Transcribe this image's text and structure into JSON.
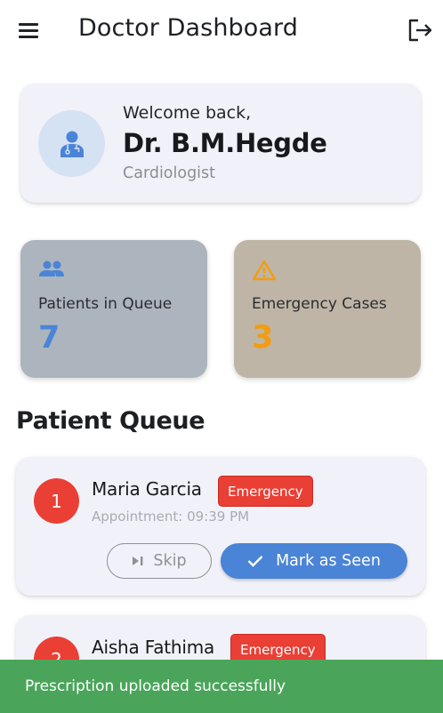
{
  "app": {
    "title": "Doctor Dashboard",
    "icons": {
      "menu": "menu-icon",
      "logout": "logout-icon"
    }
  },
  "welcome": {
    "greeting": "Welcome back,",
    "doctor_name": "Dr. B.M.Hegde",
    "specialty": "Cardiologist",
    "avatar_icon": "doctor-icon"
  },
  "stats": {
    "queue": {
      "label": "Patients in Queue",
      "value": "7",
      "icon": "people-icon",
      "color": "#4a84d6"
    },
    "emergency": {
      "label": "Emergency Cases",
      "value": "3",
      "icon": "warning-icon",
      "color": "#f39c12"
    }
  },
  "queue_section": {
    "title": "Patient Queue",
    "patients": [
      {
        "number": "1",
        "name": "Maria Garcia",
        "badge": "Emergency",
        "appointment": "Appointment: 09:39 PM",
        "skip_label": "Skip",
        "seen_label": "Mark as Seen"
      },
      {
        "number": "2",
        "name": "Aisha Fathima",
        "badge": "Emergency"
      }
    ]
  },
  "snackbar": {
    "message": "Prescription uploaded successfully",
    "color": "#4aa55a"
  },
  "colors": {
    "accent": "#4a84d6",
    "emergency": "#ea3f35",
    "card_bg": "#f1f2f9"
  }
}
